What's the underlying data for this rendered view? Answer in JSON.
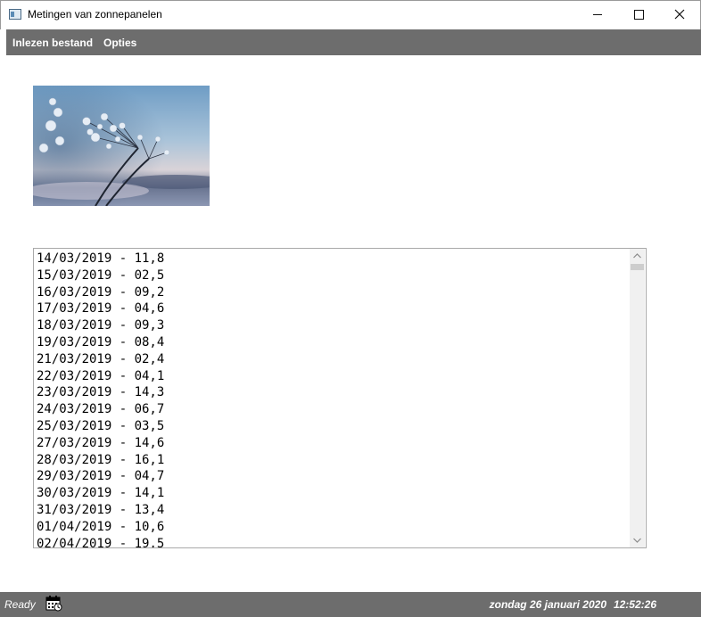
{
  "window": {
    "title": "Metingen van zonnepanelen"
  },
  "menu": {
    "items": [
      {
        "label": "Inlezen bestand"
      },
      {
        "label": "Opties"
      }
    ]
  },
  "image": {
    "icon": "frosted-plant-photo"
  },
  "listbox": {
    "items": [
      "14/03/2019 - 11,8",
      "15/03/2019 - 02,5",
      "16/03/2019 - 09,2",
      "17/03/2019 - 04,6",
      "18/03/2019 - 09,3",
      "19/03/2019 - 08,4",
      "21/03/2019 - 02,4",
      "22/03/2019 - 04,1",
      "23/03/2019 - 14,3",
      "24/03/2019 - 06,7",
      "25/03/2019 - 03,5",
      "27/03/2019 - 14,6",
      "28/03/2019 - 16,1",
      "29/03/2019 - 04,7",
      "30/03/2019 - 14,1",
      "31/03/2019 - 13,4",
      "01/04/2019 - 10,6",
      "02/04/2019 - 19,5"
    ]
  },
  "statusbar": {
    "status": "Ready",
    "date": "zondag 26 januari 2020",
    "time": "12:52:26"
  },
  "colors": {
    "bar_background": "#6d6d6d",
    "bar_text": "#ffffff"
  }
}
